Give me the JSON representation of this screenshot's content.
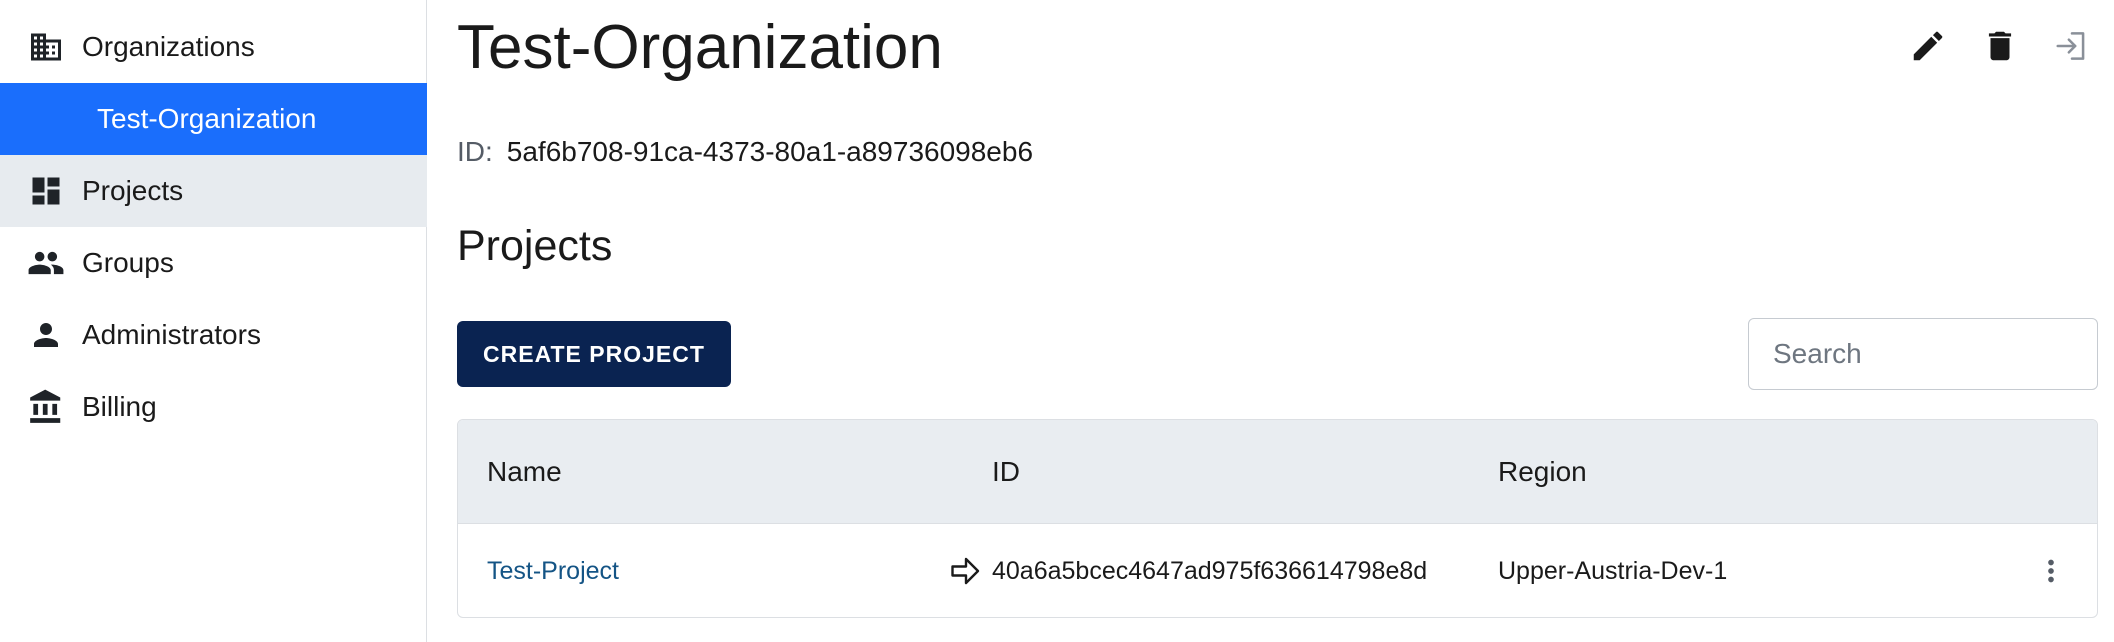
{
  "sidebar": {
    "items": [
      {
        "label": "Organizations",
        "icon": "building-icon"
      },
      {
        "label": "Test-Organization",
        "icon": ""
      },
      {
        "label": "Projects",
        "icon": "dashboard-icon"
      },
      {
        "label": "Groups",
        "icon": "people-icon"
      },
      {
        "label": "Administrators",
        "icon": "person-icon"
      },
      {
        "label": "Billing",
        "icon": "bank-icon"
      }
    ],
    "selected_color": "#1a6efc",
    "hover_color": "#e7ebef"
  },
  "header": {
    "title": "Test-Organization",
    "actions": [
      {
        "icon": "edit-icon"
      },
      {
        "icon": "delete-icon"
      },
      {
        "icon": "leave-icon"
      }
    ]
  },
  "org": {
    "id_label": "ID:",
    "id_value": "5af6b708-91ca-4373-80a1-a89736098eb6"
  },
  "projects": {
    "section_title": "Projects",
    "create_label": "CREATE PROJECT",
    "create_color": "#0a2351",
    "search_placeholder": "Search",
    "columns": [
      "Name",
      "ID",
      "Region"
    ],
    "rows": [
      {
        "name": "Test-Project",
        "id": "40a6a5bcec4647ad975f636614798e8d",
        "region": "Upper-Austria-Dev-1"
      }
    ]
  }
}
